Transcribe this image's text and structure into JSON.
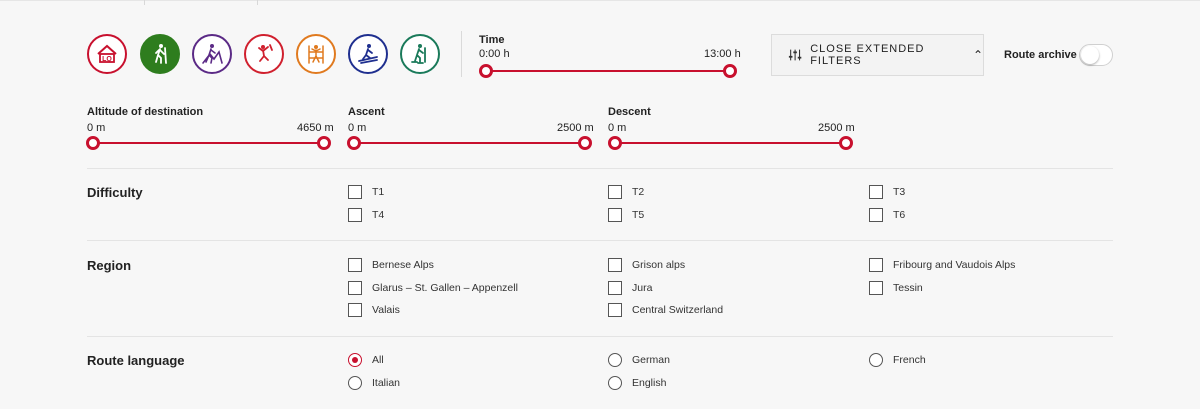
{
  "activities": [
    {
      "name": "hut",
      "color": "#c8102e",
      "filled": false
    },
    {
      "name": "hiking",
      "color": "#2e7d1e",
      "filled": true
    },
    {
      "name": "alpine-tour",
      "color": "#5b2a86",
      "filled": false
    },
    {
      "name": "climbing",
      "color": "#d0202e",
      "filled": false
    },
    {
      "name": "via-ferrata",
      "color": "#e07a1f",
      "filled": false
    },
    {
      "name": "ski-tour",
      "color": "#1f2f8f",
      "filled": false
    },
    {
      "name": "snowshoe",
      "color": "#1a7a5a",
      "filled": false
    }
  ],
  "time": {
    "label": "Time",
    "min": "0:00 h",
    "max": "13:00 h"
  },
  "filter_toggle": {
    "label": "CLOSE EXTENDED FILTERS",
    "icon": "sliders-icon"
  },
  "route_archive": {
    "label": "Route archive",
    "on": false
  },
  "altitude": {
    "label": "Altitude of destination",
    "min": "0 m",
    "max": "4650 m"
  },
  "ascent": {
    "label": "Ascent",
    "min": "0 m",
    "max": "2500 m"
  },
  "descent": {
    "label": "Descent",
    "min": "0 m",
    "max": "2500 m"
  },
  "difficulty": {
    "title": "Difficulty",
    "options": [
      "T1",
      "T2",
      "T3",
      "T4",
      "T5",
      "T6"
    ]
  },
  "region": {
    "title": "Region",
    "options": [
      "Bernese Alps",
      "Grison alps",
      "Fribourg and Vaudois Alps",
      "Glarus – St. Gallen – Appenzell",
      "Jura",
      "Tessin",
      "Valais",
      "Central Switzerland"
    ]
  },
  "language": {
    "title": "Route language",
    "selected": "All",
    "options": [
      "All",
      "German",
      "French",
      "Italian",
      "English"
    ]
  }
}
